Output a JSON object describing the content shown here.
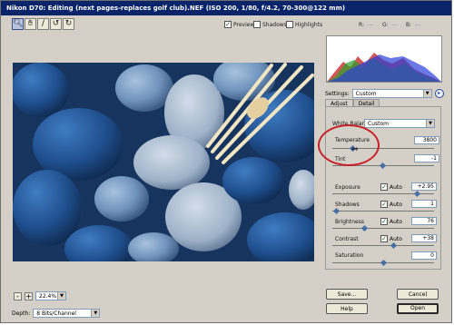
{
  "window": {
    "title": "Nikon D70:  Editing (next pages-replaces golf club).NEF  (ISO 200, 1/80, f/4.2, 70-300@122 mm)"
  },
  "toolbar": {
    "tools": [
      "zoom-tool",
      "hand-tool",
      "white-balance-tool",
      "rotate-left-tool",
      "rotate-right-tool"
    ],
    "preview_label": "Preview",
    "preview_checked": true,
    "shadows_label": "Shadows",
    "shadows_checked": false,
    "highlights_label": "Highlights",
    "highlights_checked": false,
    "r_label": "R:",
    "g_label": "G:",
    "b_label": "B:",
    "r_value": "---",
    "g_value": "---",
    "b_value": "---"
  },
  "zoom": {
    "minus_label": "-",
    "plus_label": "+",
    "value": "22.4%"
  },
  "depth": {
    "label": "Depth:",
    "value": "8 Bits/Channel"
  },
  "settings": {
    "label": "Settings:",
    "value": "Custom"
  },
  "tabs": [
    {
      "label": "Adjust",
      "active": true
    },
    {
      "label": "Detail",
      "active": false
    }
  ],
  "adjust": {
    "white_balance_label": "White Balance:",
    "white_balance_value": "Custom",
    "temperature_label": "Temperature",
    "temperature_value": "3800",
    "tint_label": "Tint",
    "tint_value": "-1",
    "exposure_label": "Exposure",
    "exposure_value": "+2.95",
    "shadows_label": "Shadows",
    "shadows_value": "1",
    "brightness_label": "Brightness",
    "brightness_value": "76",
    "contrast_label": "Contrast",
    "contrast_value": "+38",
    "saturation_label": "Saturation",
    "saturation_value": "0",
    "auto_label": "Auto"
  },
  "buttons": {
    "save": "Save...",
    "cancel": "Cancel",
    "help": "Help",
    "open": "Open"
  },
  "colors": {
    "titlebar": "#0a246a",
    "highlight_circle": "#c8202a",
    "slider_thumb": "#4a6fa5"
  }
}
